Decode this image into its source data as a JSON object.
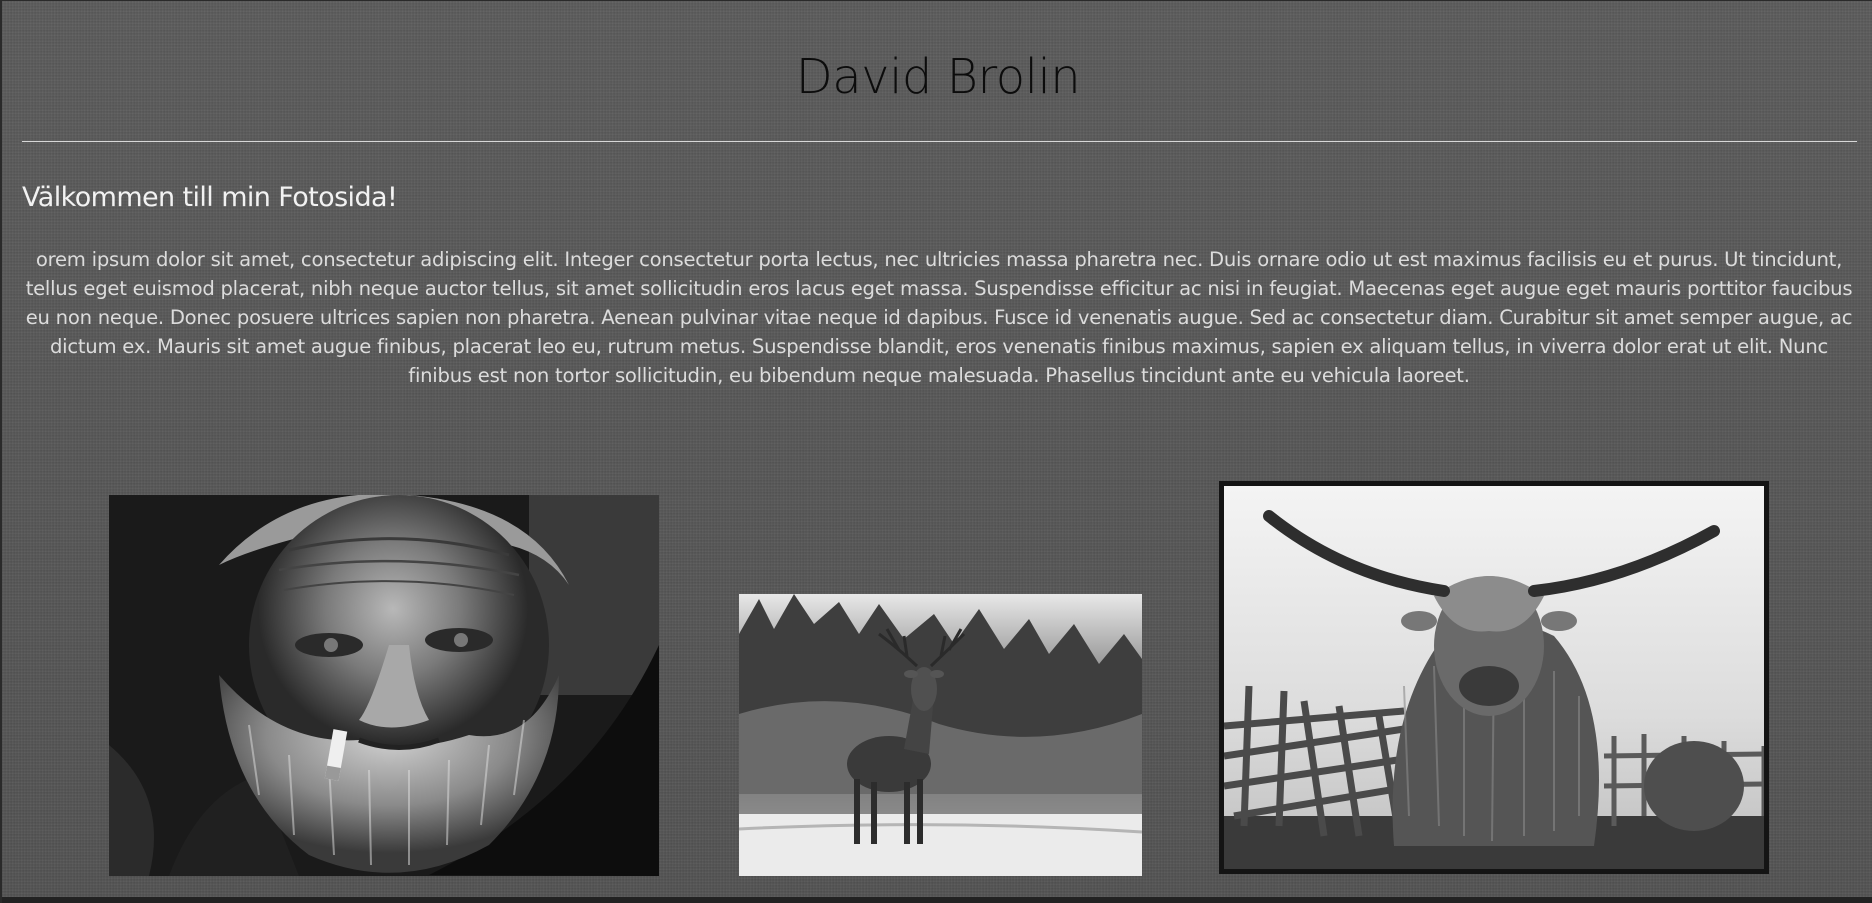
{
  "header": {
    "title": "David Brolin"
  },
  "main": {
    "welcome": "Välkommen till min Fotosida!",
    "intro": "orem ipsum dolor sit amet, consectetur adipiscing elit. Integer consectetur porta lectus, nec ultricies massa pharetra nec. Duis ornare odio ut est maximus facilisis eu et purus. Ut tincidunt, tellus eget euismod placerat, nibh neque auctor tellus, sit amet sollicitudin eros lacus eget massa. Suspendisse efficitur ac nisi in feugiat. Maecenas eget augue eget mauris porttitor faucibus eu non neque. Donec posuere ultrices sapien non pharetra. Aenean pulvinar vitae neque id dapibus. Fusce id venenatis augue. Sed ac consectetur diam. Curabitur sit amet semper augue, ac dictum ex. Mauris sit amet augue finibus, placerat leo eu, rutrum metus. Suspendisse blandit, eros venenatis finibus maximus, sapien ex aliquam tellus, in viverra dolor erat ut elit. Nunc finibus est non tortor sollicitudin, eu bibendum neque malesuada. Phasellus tincidunt ante eu vehicula laoreet."
  },
  "gallery": {
    "photos": [
      {
        "subject": "old-man-portrait",
        "tone": "black-and-white"
      },
      {
        "subject": "deer-in-snow",
        "tone": "black-and-white"
      },
      {
        "subject": "highland-cattle",
        "tone": "black-and-white"
      }
    ]
  },
  "colors": {
    "background": "#555555",
    "title": "#0c0c0c",
    "text": "#dcdcdc",
    "divider": "#d8d8d8"
  }
}
